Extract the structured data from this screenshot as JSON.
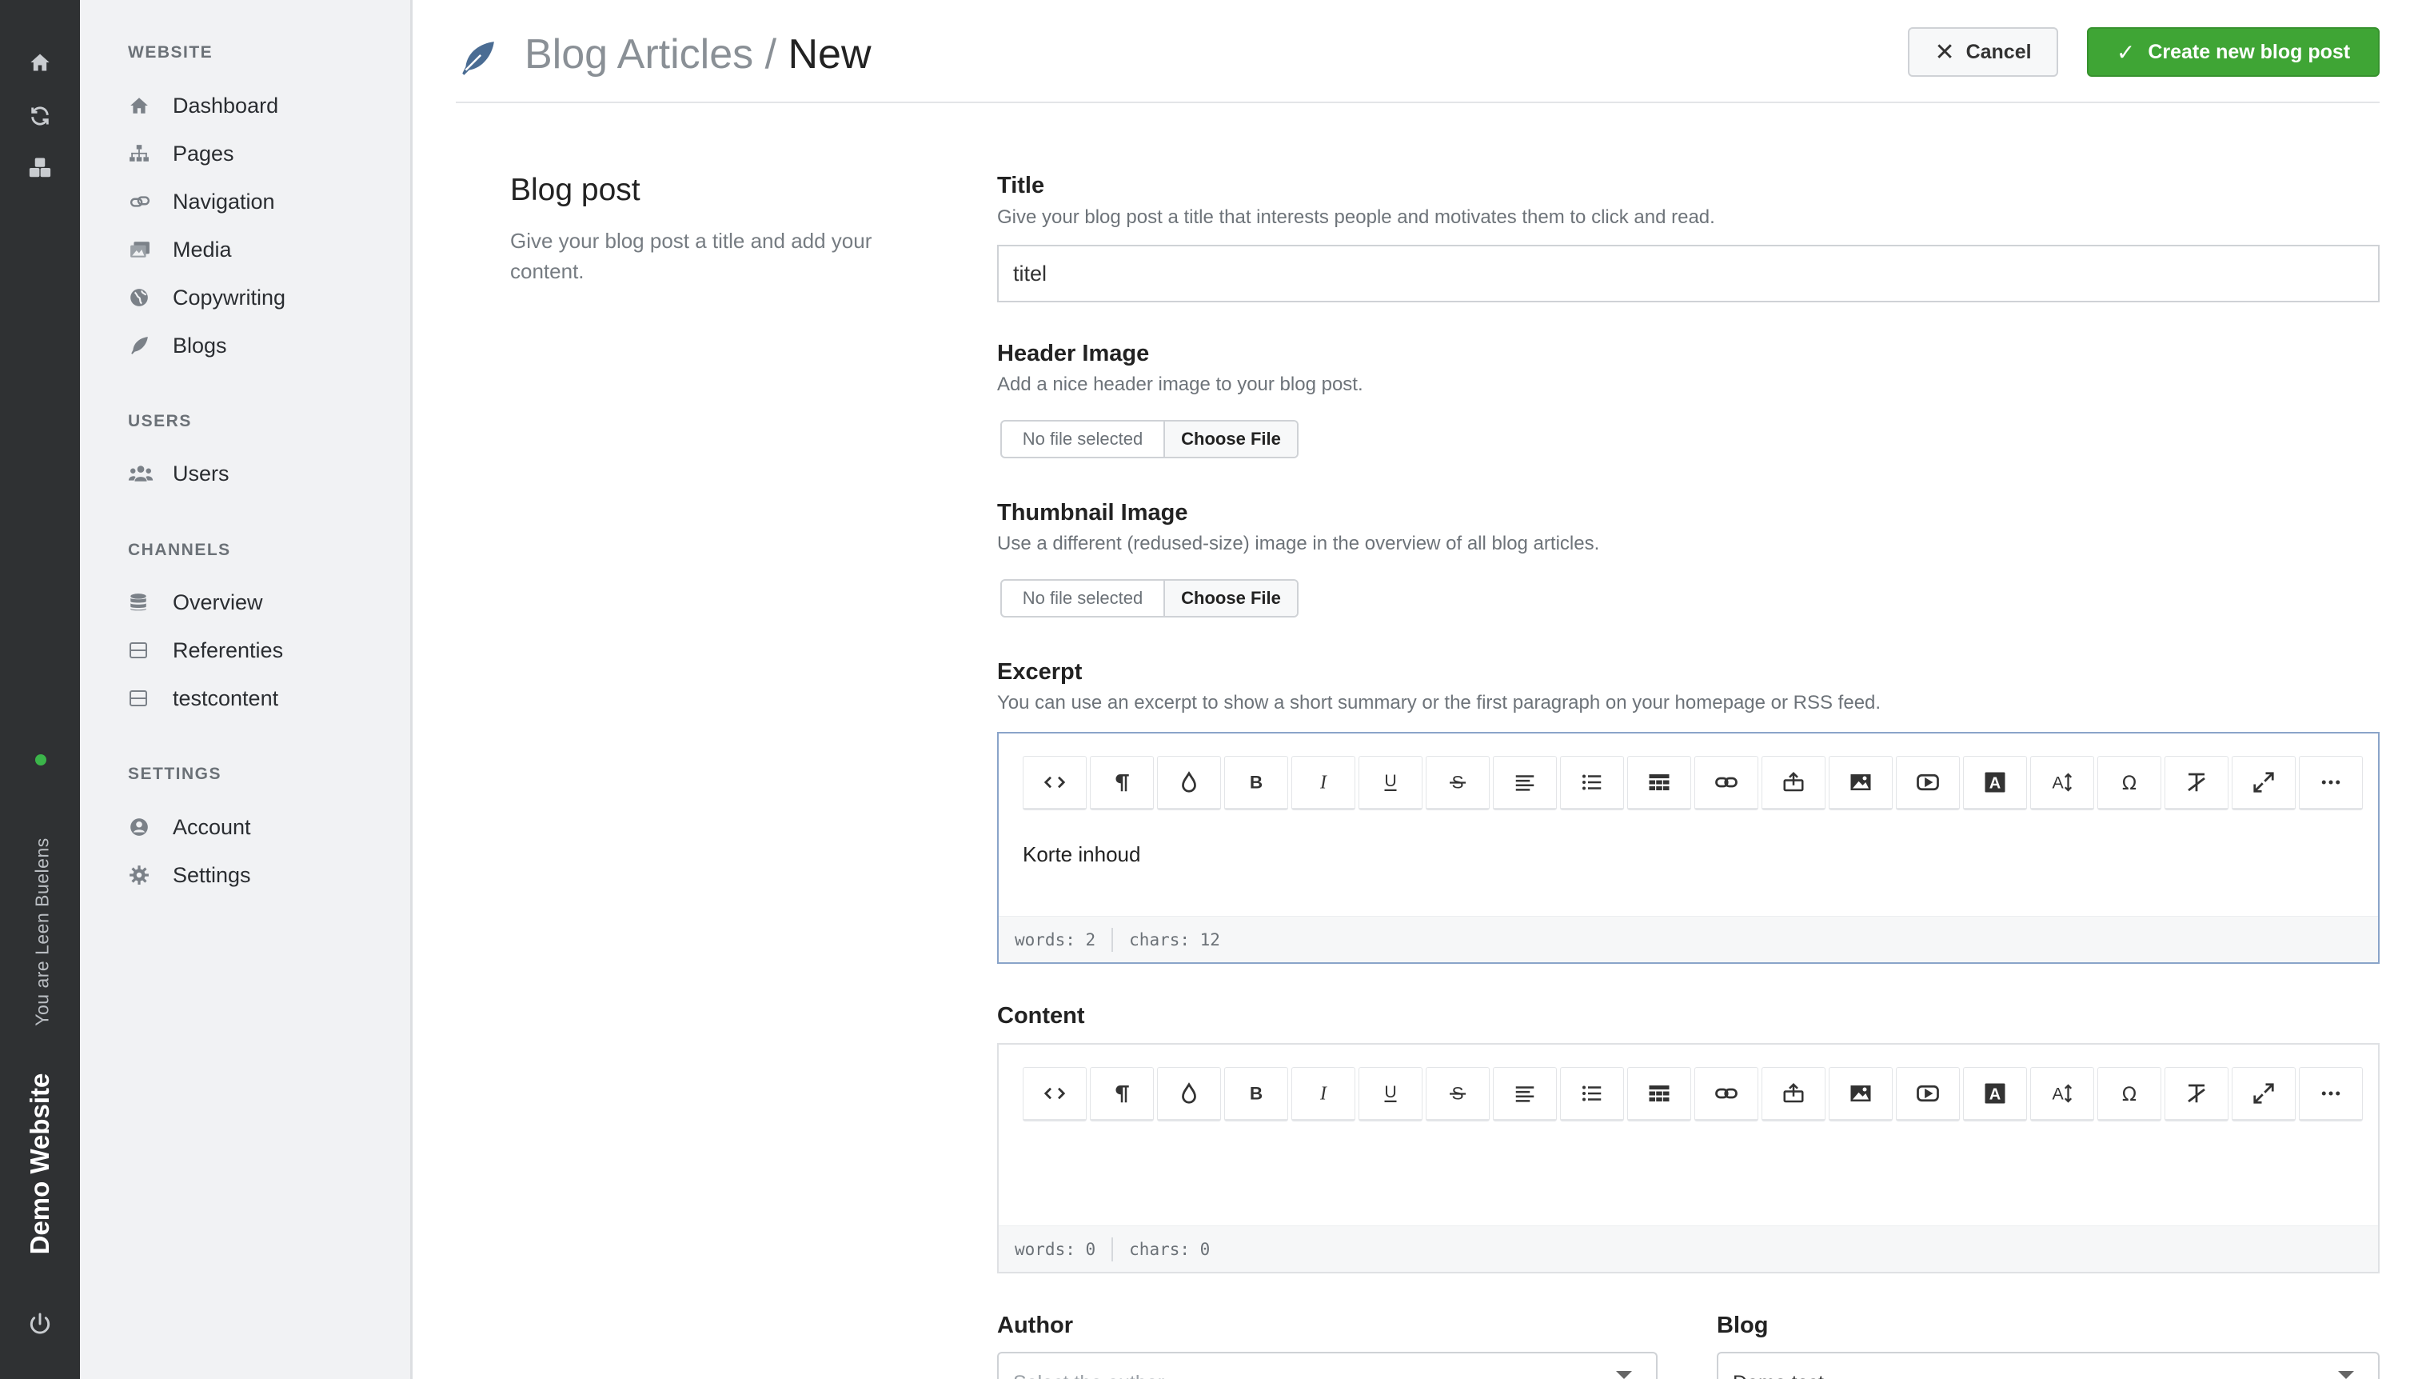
{
  "rail": {
    "user_label": "You are Leen Buelens",
    "site_name": "Demo Website"
  },
  "sidebar": {
    "website_title": "WEBSITE",
    "website_items": [
      {
        "label": "Dashboard",
        "icon": "home-icon"
      },
      {
        "label": "Pages",
        "icon": "sitemap-icon"
      },
      {
        "label": "Navigation",
        "icon": "link-icon"
      },
      {
        "label": "Media",
        "icon": "images-icon"
      },
      {
        "label": "Copywriting",
        "icon": "globe-icon"
      },
      {
        "label": "Blogs",
        "icon": "feather-icon"
      }
    ],
    "users_title": "USERS",
    "users_items": [
      {
        "label": "Users",
        "icon": "users-icon"
      }
    ],
    "channels_title": "CHANNELS",
    "channels_items": [
      {
        "label": "Overview",
        "icon": "database-icon"
      },
      {
        "label": "Referenties",
        "icon": "table-icon"
      },
      {
        "label": "testcontent",
        "icon": "table-icon"
      }
    ],
    "settings_title": "SETTINGS",
    "settings_items": [
      {
        "label": "Account",
        "icon": "user-circle-icon"
      },
      {
        "label": "Settings",
        "icon": "gear-icon"
      }
    ]
  },
  "header": {
    "breadcrumb_parent": "Blog Articles /",
    "breadcrumb_current": "New",
    "cancel_label": "Cancel",
    "create_label": "Create new blog post"
  },
  "description": {
    "title": "Blog post",
    "text": "Give your blog post a title and add your content."
  },
  "form": {
    "title_label": "Title",
    "title_help": "Give your blog post a title that interests people and motivates them to click and read.",
    "title_value": "titel",
    "header_image_label": "Header Image",
    "header_image_help": "Add a nice header image to your blog post.",
    "thumbnail_label": "Thumbnail Image",
    "thumbnail_help": "Use a different (redused-size) image in the overview of all blog articles.",
    "file_none": "No file selected",
    "file_choose": "Choose File",
    "excerpt_label": "Excerpt",
    "excerpt_help": "You can use an excerpt to show a short summary or the first paragraph on your homepage or RSS feed.",
    "excerpt_value": "Korte inhoud",
    "excerpt_words": "words: 2",
    "excerpt_chars": "chars: 12",
    "content_label": "Content",
    "content_value": "",
    "content_words": "words: 0",
    "content_chars": "chars: 0",
    "author_label": "Author",
    "author_placeholder": "Select the author",
    "blog_label": "Blog",
    "blog_value": "Demo test"
  },
  "toolbar_buttons": [
    "code-view-icon",
    "paragraph-icon",
    "color-drop-icon",
    "bold-icon",
    "italic-icon",
    "underline-icon",
    "strikethrough-icon",
    "align-icon",
    "unordered-list-icon",
    "table-icon",
    "link-icon",
    "upload-icon",
    "image-icon",
    "video-icon",
    "font-color-icon",
    "font-size-icon",
    "special-char-icon",
    "clear-format-icon",
    "fullscreen-icon",
    "more-icon"
  ]
}
